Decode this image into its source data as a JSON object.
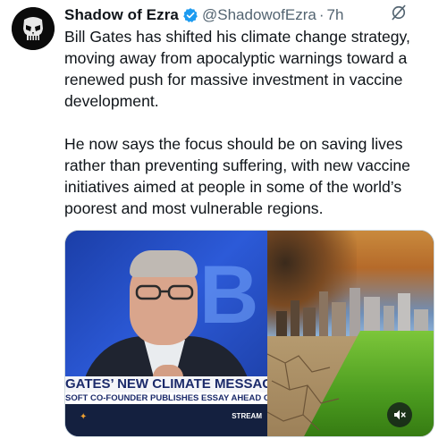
{
  "tweet": {
    "author_name": "Shadow of Ezra",
    "handle": "@ShadowofEzra",
    "separator": "·",
    "time": "7h",
    "paragraphs": [
      "Bill Gates has shifted his climate change strategy, moving away from apocalyptic warnings toward a renewed push for massive investment in vaccine development.",
      "He now says the focus should be on saving lives rather than preventing suffering, with new vaccine initiatives aimed at people in some of the world’s poorest and most vulnerable regions."
    ]
  },
  "media": {
    "headline": "GATES’ NEW CLIMATE MESSAGE",
    "subheadline": "SOFT CO-FOUNDER PUBLISHES ESSAY AHEAD OF C",
    "stream_label": "STREAM"
  },
  "icons": {
    "verified": "verified-badge-icon",
    "grok": "grok-icon",
    "mute": "mute-icon",
    "avatar": "punisher-skull-avatar"
  },
  "colors": {
    "verified_blue": "#1d9bf0",
    "secondary_text": "#536471",
    "primary_text": "#0f1419"
  }
}
